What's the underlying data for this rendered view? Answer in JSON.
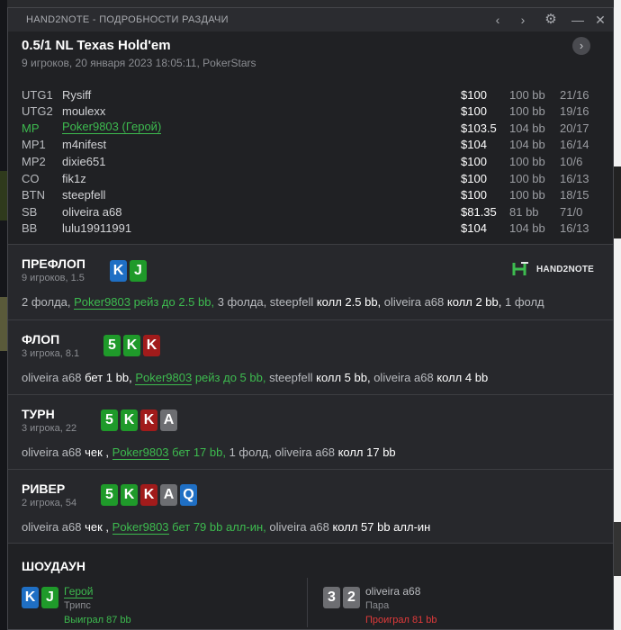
{
  "window": {
    "title": "HAND2NOTE - ПОДРОБНОСТИ РАЗДАЧИ",
    "icons": [
      "chevron-left-icon",
      "chevron-right-icon",
      "gear-icon",
      "minimize-icon",
      "close-icon"
    ]
  },
  "header": {
    "title": "0.5/1 NL Texas Hold'em",
    "subtitle": "9 игроков, 20 января 2023 18:05:11, PokerStars",
    "players": [
      {
        "pos": "UTG1",
        "name": "Rysiff",
        "stack": "$100",
        "bb": "100 bb",
        "vpip": "21/16",
        "hero": false
      },
      {
        "pos": "UTG2",
        "name": "moulexx",
        "stack": "$100",
        "bb": "100 bb",
        "vpip": "19/16",
        "hero": false
      },
      {
        "pos": "MP",
        "name": "Poker9803 (Герой)",
        "stack": "$103.5",
        "bb": "104 bb",
        "vpip": "20/17",
        "hero": true
      },
      {
        "pos": "MP1",
        "name": "m4nifest",
        "stack": "$104",
        "bb": "104 bb",
        "vpip": "16/14",
        "hero": false
      },
      {
        "pos": "MP2",
        "name": "dixie651",
        "stack": "$100",
        "bb": "100 bb",
        "vpip": "10/6",
        "hero": false
      },
      {
        "pos": "CO",
        "name": "fik1z",
        "stack": "$100",
        "bb": "100 bb",
        "vpip": "16/13",
        "hero": false
      },
      {
        "pos": "BTN",
        "name": "steepfell",
        "stack": "$100",
        "bb": "100 bb",
        "vpip": "18/15",
        "hero": false
      },
      {
        "pos": "SB",
        "name": "oliveira a68",
        "stack": "$81.35",
        "bb": "81 bb",
        "vpip": "71/0",
        "hero": false
      },
      {
        "pos": "BB",
        "name": "lulu19911991",
        "stack": "$104",
        "bb": "104 bb",
        "vpip": "16/13",
        "hero": false
      }
    ]
  },
  "logo_text": "HAND2NOTE",
  "streets": {
    "preflop": {
      "title": "ПРЕФЛОП",
      "sub": "9 игроков, 1.5",
      "cards": [
        {
          "r": "K",
          "color": "#1f6fc4"
        },
        {
          "r": "J",
          "color": "#1f9a2a"
        }
      ],
      "actions": {
        "a1": "2 фолда, ",
        "hero": "Poker9803",
        "hero_action": " рейз до 2.5 bb,",
        "a2": " 3 фолда, steepfell ",
        "a3": "колл 2.5 bb,",
        "a4": " oliveira a68 ",
        "a5": "колл 2 bb,",
        "a6": " 1 фолд"
      }
    },
    "flop": {
      "title": "ФЛОП",
      "sub": "3 игрока, 8.1",
      "cards": [
        {
          "r": "5",
          "color": "#1f9a2a"
        },
        {
          "r": "K",
          "color": "#1f9a2a"
        },
        {
          "r": "K",
          "color": "#a11b1b"
        }
      ],
      "actions": {
        "a1": "oliveira a68 ",
        "a2": "бет 1 bb,",
        "hero": "Poker9803",
        "hero_action": " рейз до 5 bb,",
        "a3": " steepfell ",
        "a4": "колл 5 bb,",
        "a5": " oliveira a68 ",
        "a6": "колл 4 bb"
      }
    },
    "turn": {
      "title": "ТУРН",
      "sub": "3 игрока, 22",
      "cards": [
        {
          "r": "5",
          "color": "#1f9a2a"
        },
        {
          "r": "K",
          "color": "#1f9a2a"
        },
        {
          "r": "K",
          "color": "#a11b1b"
        },
        {
          "r": "A",
          "color": "#6d6e72"
        }
      ],
      "actions": {
        "a1": "oliveira a68 ",
        "a2": "чек ,",
        "hero": "Poker9803",
        "hero_action": " бет 17 bb,",
        "a3": " 1 фолд, oliveira a68 ",
        "a4": "колл 17 bb"
      }
    },
    "river": {
      "title": "РИВЕР",
      "sub": "2 игрока, 54",
      "cards": [
        {
          "r": "5",
          "color": "#1f9a2a"
        },
        {
          "r": "K",
          "color": "#1f9a2a"
        },
        {
          "r": "K",
          "color": "#a11b1b"
        },
        {
          "r": "A",
          "color": "#6d6e72"
        },
        {
          "r": "Q",
          "color": "#1f6fc4"
        }
      ],
      "actions": {
        "a1": "oliveira a68 ",
        "a2": "чек ,",
        "hero": "Poker9803",
        "hero_action": " бет 79 bb алл-ин,",
        "a3": " oliveira a68 ",
        "a4": "колл 57 bb алл-ин"
      }
    }
  },
  "showdown": {
    "title": "ШОУДАУН",
    "hero": {
      "cards": [
        {
          "r": "K",
          "color": "#1f6fc4"
        },
        {
          "r": "J",
          "color": "#1f9a2a"
        }
      ],
      "name": "Герой",
      "hand": "Трипс",
      "result": "Выиграл 87 bb",
      "result_color": "#3dbb4f"
    },
    "villain": {
      "cards": [
        {
          "r": "3",
          "color": "#6d6e72"
        },
        {
          "r": "2",
          "color": "#6d6e72"
        }
      ],
      "name": "oliveira a68",
      "hand": "Пара",
      "result": "Проиграл 81 bb",
      "result_color": "#e03a3a"
    }
  }
}
